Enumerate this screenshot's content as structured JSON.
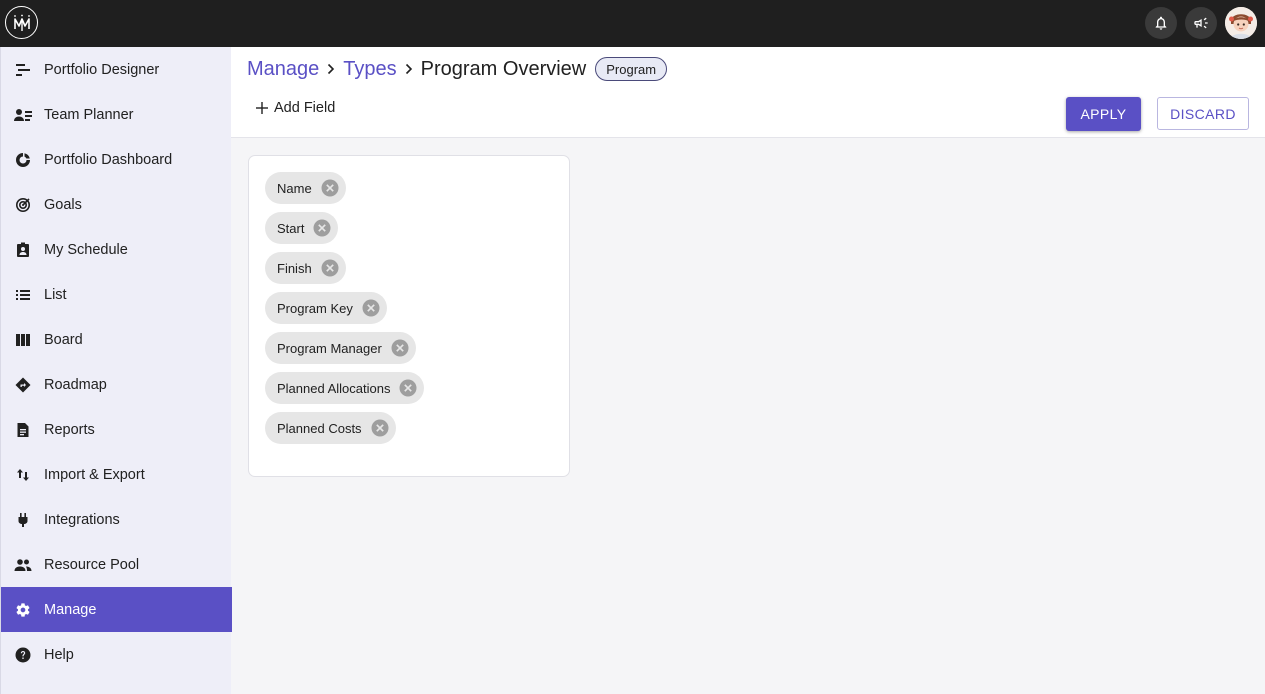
{
  "topbar": {
    "logo_icon": "logo-icon",
    "notifications_icon": "bell-icon",
    "announcements_icon": "megaphone-icon",
    "avatar_icon": "user-avatar"
  },
  "sidebar": {
    "items": [
      {
        "label": "Portfolio Designer",
        "icon": "portfolio-designer-icon"
      },
      {
        "label": "Team Planner",
        "icon": "team-planner-icon"
      },
      {
        "label": "Portfolio Dashboard",
        "icon": "dashboard-icon"
      },
      {
        "label": "Goals",
        "icon": "target-icon"
      },
      {
        "label": "My Schedule",
        "icon": "schedule-icon"
      },
      {
        "label": "List",
        "icon": "list-icon"
      },
      {
        "label": "Board",
        "icon": "board-icon"
      },
      {
        "label": "Roadmap",
        "icon": "roadmap-icon"
      },
      {
        "label": "Reports",
        "icon": "report-icon"
      },
      {
        "label": "Import & Export",
        "icon": "import-export-icon"
      },
      {
        "label": "Integrations",
        "icon": "plug-icon"
      },
      {
        "label": "Resource Pool",
        "icon": "people-icon"
      },
      {
        "label": "Manage",
        "icon": "gear-icon",
        "active": true
      },
      {
        "label": "Help",
        "icon": "help-icon"
      }
    ]
  },
  "header": {
    "breadcrumb": [
      "Manage",
      "Types"
    ],
    "title": "Program Overview",
    "type_badge": "Program",
    "add_field_label": "Add Field",
    "apply_label": "APPLY",
    "discard_label": "DISCARD"
  },
  "fields": [
    "Name",
    "Start",
    "Finish",
    "Program Key",
    "Program Manager",
    "Planned Allocations",
    "Planned Costs"
  ],
  "colors": {
    "accent": "#5a50c5",
    "topbar": "#1f1f1f",
    "sidebar": "#eeeef8",
    "chip": "#e6e6e6"
  }
}
